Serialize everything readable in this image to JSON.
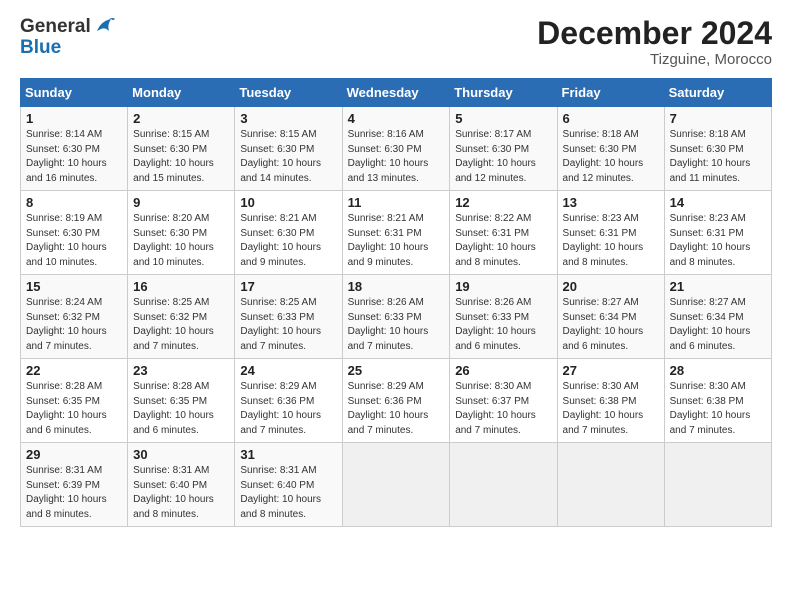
{
  "header": {
    "logo_general": "General",
    "logo_blue": "Blue",
    "title": "December 2024",
    "subtitle": "Tizguine, Morocco"
  },
  "weekdays": [
    "Sunday",
    "Monday",
    "Tuesday",
    "Wednesday",
    "Thursday",
    "Friday",
    "Saturday"
  ],
  "weeks": [
    [
      {
        "day": "1",
        "sunrise": "8:14 AM",
        "sunset": "6:30 PM",
        "daylight": "10 hours and 16 minutes."
      },
      {
        "day": "2",
        "sunrise": "8:15 AM",
        "sunset": "6:30 PM",
        "daylight": "10 hours and 15 minutes."
      },
      {
        "day": "3",
        "sunrise": "8:15 AM",
        "sunset": "6:30 PM",
        "daylight": "10 hours and 14 minutes."
      },
      {
        "day": "4",
        "sunrise": "8:16 AM",
        "sunset": "6:30 PM",
        "daylight": "10 hours and 13 minutes."
      },
      {
        "day": "5",
        "sunrise": "8:17 AM",
        "sunset": "6:30 PM",
        "daylight": "10 hours and 12 minutes."
      },
      {
        "day": "6",
        "sunrise": "8:18 AM",
        "sunset": "6:30 PM",
        "daylight": "10 hours and 12 minutes."
      },
      {
        "day": "7",
        "sunrise": "8:18 AM",
        "sunset": "6:30 PM",
        "daylight": "10 hours and 11 minutes."
      }
    ],
    [
      {
        "day": "8",
        "sunrise": "8:19 AM",
        "sunset": "6:30 PM",
        "daylight": "10 hours and 10 minutes."
      },
      {
        "day": "9",
        "sunrise": "8:20 AM",
        "sunset": "6:30 PM",
        "daylight": "10 hours and 10 minutes."
      },
      {
        "day": "10",
        "sunrise": "8:21 AM",
        "sunset": "6:30 PM",
        "daylight": "10 hours and 9 minutes."
      },
      {
        "day": "11",
        "sunrise": "8:21 AM",
        "sunset": "6:31 PM",
        "daylight": "10 hours and 9 minutes."
      },
      {
        "day": "12",
        "sunrise": "8:22 AM",
        "sunset": "6:31 PM",
        "daylight": "10 hours and 8 minutes."
      },
      {
        "day": "13",
        "sunrise": "8:23 AM",
        "sunset": "6:31 PM",
        "daylight": "10 hours and 8 minutes."
      },
      {
        "day": "14",
        "sunrise": "8:23 AM",
        "sunset": "6:31 PM",
        "daylight": "10 hours and 8 minutes."
      }
    ],
    [
      {
        "day": "15",
        "sunrise": "8:24 AM",
        "sunset": "6:32 PM",
        "daylight": "10 hours and 7 minutes."
      },
      {
        "day": "16",
        "sunrise": "8:25 AM",
        "sunset": "6:32 PM",
        "daylight": "10 hours and 7 minutes."
      },
      {
        "day": "17",
        "sunrise": "8:25 AM",
        "sunset": "6:33 PM",
        "daylight": "10 hours and 7 minutes."
      },
      {
        "day": "18",
        "sunrise": "8:26 AM",
        "sunset": "6:33 PM",
        "daylight": "10 hours and 7 minutes."
      },
      {
        "day": "19",
        "sunrise": "8:26 AM",
        "sunset": "6:33 PM",
        "daylight": "10 hours and 6 minutes."
      },
      {
        "day": "20",
        "sunrise": "8:27 AM",
        "sunset": "6:34 PM",
        "daylight": "10 hours and 6 minutes."
      },
      {
        "day": "21",
        "sunrise": "8:27 AM",
        "sunset": "6:34 PM",
        "daylight": "10 hours and 6 minutes."
      }
    ],
    [
      {
        "day": "22",
        "sunrise": "8:28 AM",
        "sunset": "6:35 PM",
        "daylight": "10 hours and 6 minutes."
      },
      {
        "day": "23",
        "sunrise": "8:28 AM",
        "sunset": "6:35 PM",
        "daylight": "10 hours and 6 minutes."
      },
      {
        "day": "24",
        "sunrise": "8:29 AM",
        "sunset": "6:36 PM",
        "daylight": "10 hours and 7 minutes."
      },
      {
        "day": "25",
        "sunrise": "8:29 AM",
        "sunset": "6:36 PM",
        "daylight": "10 hours and 7 minutes."
      },
      {
        "day": "26",
        "sunrise": "8:30 AM",
        "sunset": "6:37 PM",
        "daylight": "10 hours and 7 minutes."
      },
      {
        "day": "27",
        "sunrise": "8:30 AM",
        "sunset": "6:38 PM",
        "daylight": "10 hours and 7 minutes."
      },
      {
        "day": "28",
        "sunrise": "8:30 AM",
        "sunset": "6:38 PM",
        "daylight": "10 hours and 7 minutes."
      }
    ],
    [
      {
        "day": "29",
        "sunrise": "8:31 AM",
        "sunset": "6:39 PM",
        "daylight": "10 hours and 8 minutes."
      },
      {
        "day": "30",
        "sunrise": "8:31 AM",
        "sunset": "6:40 PM",
        "daylight": "10 hours and 8 minutes."
      },
      {
        "day": "31",
        "sunrise": "8:31 AM",
        "sunset": "6:40 PM",
        "daylight": "10 hours and 8 minutes."
      },
      null,
      null,
      null,
      null
    ]
  ]
}
